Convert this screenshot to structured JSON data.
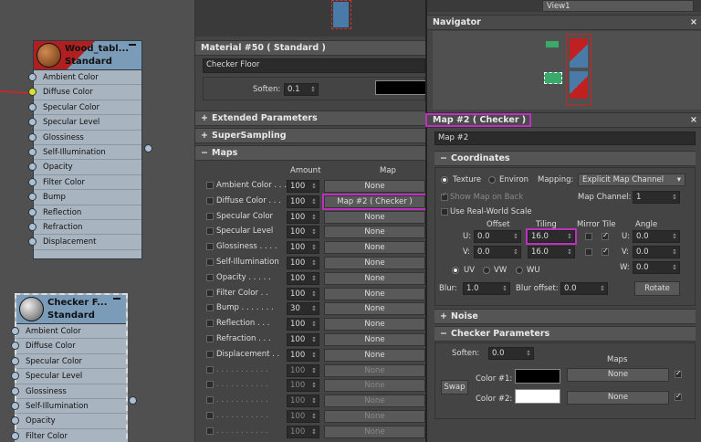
{
  "graph": {
    "node1": {
      "title": "Wood_tabl...",
      "subtitle": "Standard",
      "slots": [
        "Ambient Color",
        "Diffuse Color",
        "Specular Color",
        "Specular Level",
        "Glossiness",
        "Self-Illumination",
        "Opacity",
        "Filter Color",
        "Bump",
        "Reflection",
        "Refraction",
        "Displacement"
      ]
    },
    "node2": {
      "title": "Checker F...",
      "subtitle": "Standard",
      "slots": [
        "Ambient Color",
        "Diffuse Color",
        "Specular Color",
        "Specular Level",
        "Glossiness",
        "Self-Illumination",
        "Opacity",
        "Filter Color"
      ]
    }
  },
  "material_panel": {
    "title": "Material #50  ( Standard )",
    "name_value": "Checker Floor",
    "soften_label": "Soften:",
    "soften_value": "0.1",
    "rollouts": {
      "extended": "Extended Parameters",
      "supersampling": "SuperSampling",
      "maps": "Maps"
    },
    "maps_header_amount": "Amount",
    "maps_header_map": "Map",
    "maps_rows": [
      {
        "label": "Ambient Color . . .",
        "amount": "100",
        "map": "None"
      },
      {
        "label": "Diffuse Color . . .",
        "amount": "100",
        "map": "Map #2  ( Checker )"
      },
      {
        "label": "Specular Color",
        "amount": "100",
        "map": "None"
      },
      {
        "label": "Specular Level",
        "amount": "100",
        "map": "None"
      },
      {
        "label": "Glossiness . . . .",
        "amount": "100",
        "map": "None"
      },
      {
        "label": "Self-Illumination",
        "amount": "100",
        "map": "None"
      },
      {
        "label": "Opacity . . . . .",
        "amount": "100",
        "map": "None"
      },
      {
        "label": "Filter Color . .",
        "amount": "100",
        "map": "None"
      },
      {
        "label": "Bump . . . . . . .",
        "amount": "30",
        "map": "None"
      },
      {
        "label": "Reflection . . .",
        "amount": "100",
        "map": "None"
      },
      {
        "label": "Refraction . . .",
        "amount": "100",
        "map": "None"
      },
      {
        "label": "Displacement . .",
        "amount": "100",
        "map": "None"
      },
      {
        "label": ". . . . . . . . . . .",
        "amount": "100",
        "map": "None"
      },
      {
        "label": ". . . . . . . . . . .",
        "amount": "100",
        "map": "None"
      },
      {
        "label": ". . . . . . . . . . .",
        "amount": "100",
        "map": "None"
      },
      {
        "label": ". . . . . . . . . . .",
        "amount": "100",
        "map": "None"
      },
      {
        "label": ". . . . . . . . . . .",
        "amount": "100",
        "map": "None"
      }
    ]
  },
  "view_dropdown": "View1",
  "navigator": {
    "title": "Navigator"
  },
  "map_panel": {
    "title": "Map #2  ( Checker )",
    "name_value": "Map #2",
    "coordinates": {
      "title": "Coordinates",
      "texture": "Texture",
      "environ": "Environ",
      "mapping_label": "Mapping:",
      "mapping_value": "Explicit Map Channel",
      "show_map_on_back": "Show Map on Back",
      "map_channel_label": "Map Channel:",
      "map_channel_value": "1",
      "use_real_world": "Use Real-World Scale",
      "offset_label": "Offset",
      "tiling_label": "Tiling",
      "mirror_tile_label": "Mirror Tile",
      "angle_label": "Angle",
      "u_label": "U:",
      "v_label": "V:",
      "w_label": "W:",
      "u_offset": "0.0",
      "v_offset": "0.0",
      "u_tiling": "16.0",
      "v_tiling": "16.0",
      "u_angle": "0.0",
      "v_angle": "0.0",
      "w_angle": "0.0",
      "uv": "UV",
      "vw": "VW",
      "wu": "WU",
      "blur_label": "Blur:",
      "blur_value": "1.0",
      "blur_offset_label": "Blur offset:",
      "blur_offset_value": "0.0",
      "rotate": "Rotate"
    },
    "noise": "Noise",
    "checker": {
      "title": "Checker Parameters",
      "soften_label": "Soften:",
      "soften_value": "0.0",
      "maps_label": "Maps",
      "swap": "Swap",
      "color1_label": "Color #1:",
      "color2_label": "Color #2:",
      "color1": "#000000",
      "color2": "#ffffff",
      "map1": "None",
      "map2": "None"
    }
  },
  "colors": {
    "highlight": "#c030c0",
    "node_header": "#7a9cb8",
    "wire": "#e02020"
  }
}
